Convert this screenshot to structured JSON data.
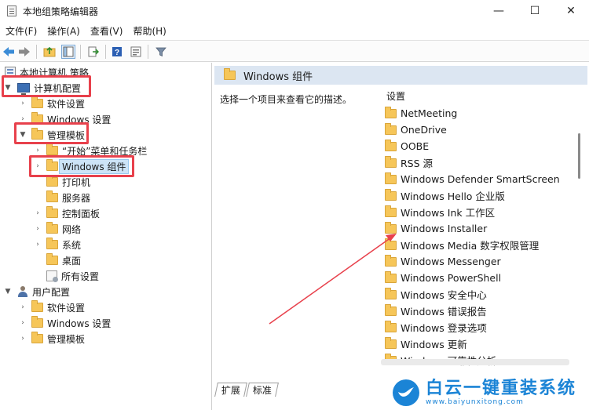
{
  "window": {
    "title": "本地组策略编辑器",
    "minimize": "—",
    "maximize": "☐",
    "close": "✕"
  },
  "menu": [
    "文件(F)",
    "操作(A)",
    "查看(V)",
    "帮助(H)"
  ],
  "tree": {
    "root": "本地计算机 策略",
    "computer_config": "计算机配置",
    "software_settings": "软件设置",
    "windows_settings": "Windows 设置",
    "admin_templates": "管理模板",
    "start_menu": "“开始”菜单和任务栏",
    "windows_components": "Windows 组件",
    "printers": "打印机",
    "server": "服务器",
    "control_panel": "控制面板",
    "network": "网络",
    "system": "系统",
    "desktop": "桌面",
    "all_settings": "所有设置",
    "user_config": "用户配置",
    "user_software_settings": "软件设置",
    "user_windows_settings": "Windows 设置",
    "user_admin_templates": "管理模板"
  },
  "right": {
    "header": "Windows 组件",
    "description": "选择一个项目来查看它的描述。",
    "column_header": "设置",
    "items": [
      "NetMeeting",
      "OneDrive",
      "OOBE",
      "RSS 源",
      "Windows Defender SmartScreen",
      "Windows Hello 企业版",
      "Windows Ink 工作区",
      "Windows Installer",
      "Windows Media 数字权限管理",
      "Windows Messenger",
      "Windows PowerShell",
      "Windows 安全中心",
      "Windows 错误报告",
      "Windows 登录选项",
      "Windows 更新",
      "Windows 可靠性分析"
    ],
    "tabs": [
      "扩展",
      "标准"
    ]
  },
  "watermark": {
    "title": "白云一键重装系统",
    "url": "www.baiyunxitong.com"
  },
  "colors": {
    "annotation_red": "#e8414c",
    "header_blue": "#dce6f2",
    "selection_blue": "#cce4f7",
    "brand_blue": "#1b84d6"
  }
}
